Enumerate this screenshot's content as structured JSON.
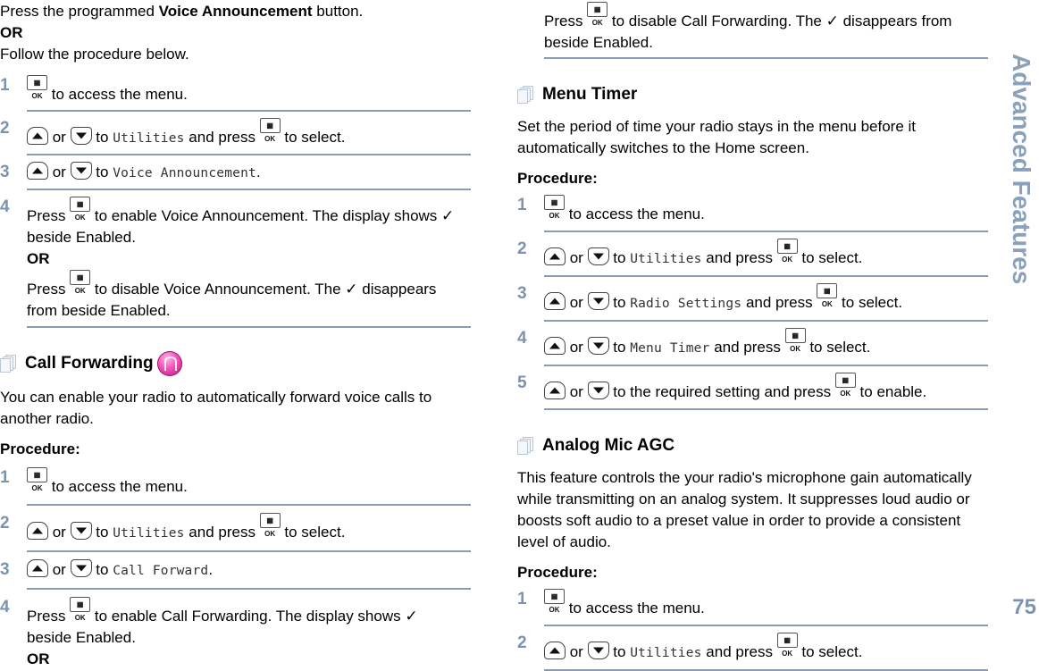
{
  "sidebar_tab": "Advanced Features",
  "page_number": "75",
  "accent_color": "#7d93ad",
  "icons": {
    "menu_ok": "menu-ok-key-icon",
    "up": "up-arrow-key-icon",
    "down": "down-arrow-key-icon",
    "section": "document-stack-icon",
    "repeater": "repeater-mode-icon",
    "check": "✓"
  },
  "left": {
    "intro_press": "Press the programmed ",
    "intro_bold": "Voice Announcement",
    "intro_button": " button.",
    "or": "OR",
    "follow": "Follow the procedure below.",
    "va_steps": [
      {
        "num": "1",
        "text": " to access the menu."
      },
      {
        "num": "2",
        "or": " or ",
        "to": " to ",
        "menu": "Utilities",
        "press": " and press ",
        "end": " to select."
      },
      {
        "num": "3",
        "or": " or ",
        "to": " to ",
        "menu": "Voice Announcement",
        "end": "."
      },
      {
        "num": "4",
        "a1": "Press ",
        "a2": " to enable Voice Announcement. The display shows ",
        "a3": " beside Enabled.",
        "or": "OR",
        "b1": "Press ",
        "b2": " to disable Voice Announcement. The ",
        "b3": " disappears from beside Enabled."
      }
    ],
    "cf_heading": "Call Forwarding",
    "cf_desc": "You can enable your radio to automatically forward voice calls to another radio.",
    "procedure": "Procedure:",
    "cf_steps": [
      {
        "num": "1",
        "text": " to access the menu."
      },
      {
        "num": "2",
        "or": " or ",
        "to": " to ",
        "menu": "Utilities",
        "press": " and press ",
        "end": " to select."
      },
      {
        "num": "3",
        "or": " or ",
        "to": " to ",
        "menu": "Call Forward",
        "end": "."
      },
      {
        "num": "4",
        "a1": "Press ",
        "a2": " to enable Call Forwarding. The display shows ",
        "a3": " beside Enabled.",
        "or": "OR"
      }
    ]
  },
  "right": {
    "cf_cont1": "Press ",
    "cf_cont2": " to disable Call Forwarding. The ",
    "cf_cont3": " disappears from beside Enabled.",
    "mt_heading": "Menu Timer",
    "mt_desc": "Set the period of time your radio stays in the menu before it automatically switches to the Home screen.",
    "procedure": "Procedure:",
    "mt_steps": [
      {
        "num": "1",
        "text": " to access the menu."
      },
      {
        "num": "2",
        "or": " or ",
        "to": " to ",
        "menu": "Utilities",
        "press": " and press ",
        "end": " to select."
      },
      {
        "num": "3",
        "or": " or ",
        "to": " to ",
        "menu": "Radio Settings",
        "press": " and press ",
        "end": " to select."
      },
      {
        "num": "4",
        "or": " or ",
        "to": " to ",
        "menu": "Menu Timer",
        "press": " and press ",
        "end": " to select."
      },
      {
        "num": "5",
        "or": " or ",
        "to": " to the required setting and press ",
        "end": " to enable."
      }
    ],
    "agc_heading": "Analog Mic AGC",
    "agc_desc": "This feature controls the your radio's microphone gain automatically while transmitting on an analog system. It suppresses loud audio or boosts soft audio to a preset value in order to provide a consistent level of audio.",
    "agc_steps": [
      {
        "num": "1",
        "text": " to access the menu."
      },
      {
        "num": "2",
        "or": " or ",
        "to": " to ",
        "menu": "Utilities",
        "press": " and press ",
        "end": " to select."
      }
    ]
  },
  "ok_key_label": "▦ OK"
}
